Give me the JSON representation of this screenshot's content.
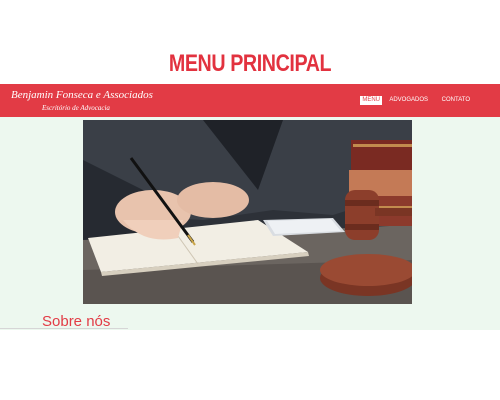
{
  "page": {
    "heading": "MENU PRINCIPAL"
  },
  "header": {
    "brand_name": "Benjamin Fonseca e Associados",
    "brand_tagline": "Escritório de Advocacia"
  },
  "nav": {
    "items": [
      {
        "label": "MENU",
        "active": true
      },
      {
        "label": "ADVOGADOS",
        "active": false
      },
      {
        "label": "CONTATO",
        "active": false
      }
    ]
  },
  "hero": {
    "image_name": "lawyer-writing-with-gavel-photo"
  },
  "section": {
    "title": "Sobre nós"
  },
  "colors": {
    "brand_red": "#e23b45",
    "content_background": "#edf8ef",
    "white": "#ffffff"
  }
}
